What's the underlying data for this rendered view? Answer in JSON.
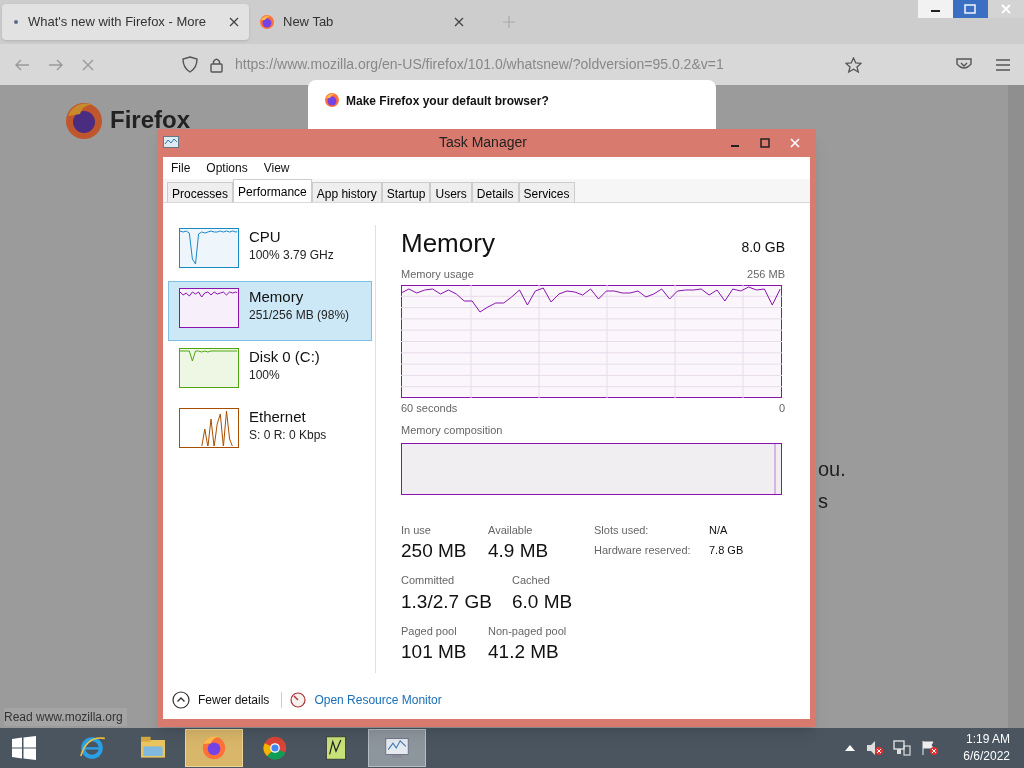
{
  "browser": {
    "tabs": [
      {
        "title": "What's new with Firefox - More",
        "selected": true,
        "kind": "dot"
      },
      {
        "title": "New Tab",
        "selected": false,
        "kind": "firefox"
      }
    ],
    "url": "https://www.mozilla.org/en-US/firefox/101.0/whatsnew/?oldversion=95.0.2&v=1",
    "logo_text": "Firefox",
    "text_fragments": [
      "ou.",
      "s"
    ],
    "dialog_title": "Make Firefox your default browser?",
    "status_text": "Read www.mozilla.org"
  },
  "task_manager": {
    "title": "Task Manager",
    "menu": [
      "File",
      "Options",
      "View"
    ],
    "tabs": [
      {
        "label": "Processes",
        "selected": false
      },
      {
        "label": "Performance",
        "selected": true
      },
      {
        "label": "App history",
        "selected": false
      },
      {
        "label": "Startup",
        "selected": false
      },
      {
        "label": "Users",
        "selected": false
      },
      {
        "label": "Details",
        "selected": false
      },
      {
        "label": "Services",
        "selected": false
      }
    ],
    "sidebar": [
      {
        "name": "CPU",
        "detail": "100% 3.79 GHz",
        "selected": false,
        "color": "#1a8ac6"
      },
      {
        "name": "Memory",
        "detail": "251/256 MB (98%)",
        "selected": true,
        "color": "#8b12ae"
      },
      {
        "name": "Disk 0 (C:)",
        "detail": "100%",
        "selected": false,
        "color": "#4da60c"
      },
      {
        "name": "Ethernet",
        "detail": "S: 0 R: 0 Kbps",
        "selected": false,
        "color": "#a74f01"
      }
    ],
    "heading": "Memory",
    "capacity": "8.0 GB",
    "usage_label": "Memory usage",
    "usage_max": "256 MB",
    "time_start": "60 seconds",
    "time_end": "0",
    "composition_label": "Memory composition",
    "stats": [
      [
        {
          "label": "In use",
          "value": "250 MB"
        },
        {
          "label": "Available",
          "value": "4.9 MB"
        }
      ],
      [
        {
          "label": "Committed",
          "value": "1.3/2.7 GB"
        },
        {
          "label": "Cached",
          "value": "6.0 MB"
        }
      ],
      [
        {
          "label": "Paged pool",
          "value": "101 MB"
        },
        {
          "label": "Non-paged pool",
          "value": "41.2 MB"
        }
      ]
    ],
    "hardware": [
      {
        "label": "Slots used:",
        "value": "N/A"
      },
      {
        "label": "Hardware reserved:",
        "value": "7.8 GB"
      }
    ],
    "fewer_details": "Fewer details",
    "resource_monitor_link": "Open Resource Monitor"
  },
  "taskbar": {
    "apps": [
      {
        "kind": "ie",
        "hovered": false,
        "open": false
      },
      {
        "kind": "explorer",
        "hovered": false,
        "open": false
      },
      {
        "kind": "firefox",
        "hovered": true,
        "open": true
      },
      {
        "kind": "chrome",
        "hovered": false,
        "open": false
      },
      {
        "kind": "notepad",
        "hovered": false,
        "open": false
      },
      {
        "kind": "taskmgr",
        "hovered": false,
        "open": true
      }
    ],
    "time": "1:19 AM",
    "date": "6/6/2022"
  }
}
